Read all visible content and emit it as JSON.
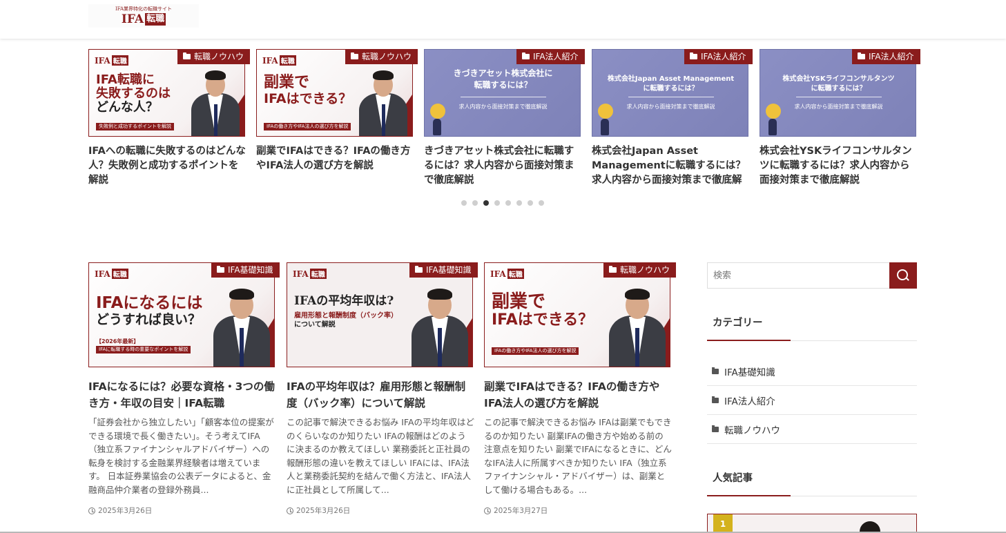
{
  "header": {
    "logo_tagline": "IFA業界特化の転職サイト",
    "logo_ifa": "IFA",
    "logo_job": "転職"
  },
  "carousel": {
    "cards": [
      {
        "category": "転職ノウハウ",
        "title": "IFAへの転職に失敗するのはどんな人？失敗例と成功するポイントを解説",
        "thumb": {
          "line1": "IFA転職に",
          "line2": "失敗するのは",
          "line3": "どんな人？",
          "bar": "失敗例と成功するポイントを解説"
        }
      },
      {
        "category": "転職ノウハウ",
        "title": "副業でIFAはできる？IFAの働き方やIFA法人の選び方を解説",
        "thumb": {
          "line1": "副業で",
          "line2": "IFAはできる？",
          "bar": "IFAの働き方やIFA法人の選び方を解説"
        }
      },
      {
        "category": "IFA法人紹介",
        "title": "きづきアセット株式会社に転職するには？求人内容から面接対策まで徹底解説",
        "thumb": {
          "line1": "きづきアセット株式会社に",
          "line2": "転職するには？",
          "sub": "求人内容から面接対策まで徹底解説"
        }
      },
      {
        "category": "IFA法人紹介",
        "title": "株式会社Japan Asset Managementに転職するには？求人内容から面接対策まで徹底解",
        "thumb": {
          "line1": "株式会社Japan Asset Management",
          "line2": "に転職するには？",
          "sub": "求人内容から面接対策まで徹底解説"
        }
      },
      {
        "category": "IFA法人紹介",
        "title": "株式会社YSKライフコンサルタンツに転職するには？求人内容から面接対策まで徹底解説",
        "thumb": {
          "line1": "株式会社YSKライフコンサルタンツ",
          "line2": "に転職するには？",
          "sub": "求人内容から面接対策まで徹底解説"
        }
      }
    ],
    "dots": {
      "count": 8,
      "active_index": 2
    }
  },
  "posts": [
    {
      "category": "IFA基礎知識",
      "title": "IFAになるには？必要な資格・3つの働き方・年収の目安｜IFA転職",
      "excerpt": "「証券会社から独立したい」「顧客本位の提案ができる環境で長く働きたい」。そう考えてIFA（独立系ファイナンシャルアドバイザー）への転身を検討する金融業界経験者は増えています。 日本証券業協会の公表データによると、金融商品仲介業者の登録外務員...",
      "date": "2025年3月26日",
      "thumb": {
        "line1": "IFAになるには",
        "line2": "どうすれば良い？",
        "sub": "【2026年最新】",
        "bar": "IFAに転職する時の重要なポイントを解説"
      }
    },
    {
      "category": "IFA基礎知識",
      "title": "IFAの平均年収は？雇用形態と報酬制度（バック率）について解説",
      "excerpt": "この記事で解決できるお悩み IFAの平均年収はどのくらいなのか知りたい IFAの報酬はどのように決まるのか教えてほしい 業務委託と正社員の報酬形態の違いを教えてほしい IFAには、IFA法人と業務委託契約を結んで働く方法と、IFA法人に正社員として所属して...",
      "date": "2025年3月26日",
      "thumb": {
        "line1": "IFAの平均年収は?",
        "line2": "雇用形態と報酬制度（バック率）",
        "line3": "について解説"
      }
    },
    {
      "category": "転職ノウハウ",
      "title": "副業でIFAはできる？IFAの働き方やIFA法人の選び方を解説",
      "excerpt": "この記事で解決できるお悩み IFAは副業でもできるのか知りたい 副業IFAの働き方や始める前の注意点を知りたい 副業でIFAになるときに、どんなIFA法人に所属すべきか知りたい IFA（独立系ファイナンシャル・アドバイザー）は、副業として働ける場合もある。...",
      "date": "2025年3月27日",
      "thumb": {
        "line1": "副業で",
        "line2": "IFAはできる？",
        "bar": "IFAの働き方やIFA法人の選び方を解説"
      }
    }
  ],
  "sidebar": {
    "search_placeholder": "検索",
    "categories_title": "カテゴリー",
    "categories": [
      "IFA基礎知識",
      "IFA法人紹介",
      "転職ノウハウ"
    ],
    "popular_title": "人気記事",
    "popular_rank": "1"
  },
  "colors": {
    "brand": "#8a1c1c",
    "purple": "#8b8fc4",
    "text": "#333333"
  }
}
